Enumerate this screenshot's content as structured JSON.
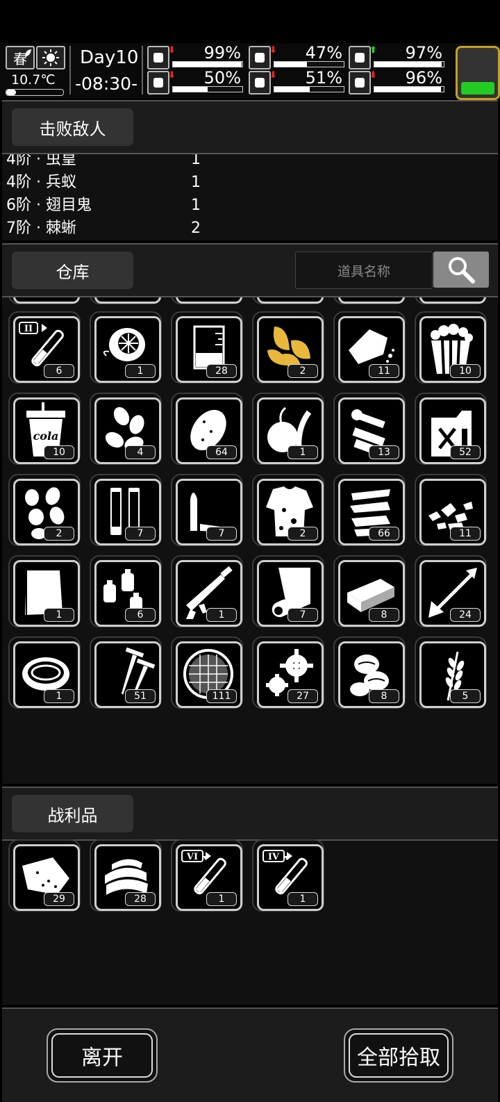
{
  "status": {
    "season": "春",
    "temperature": "10.7℃",
    "day": "Day10",
    "time": "-08:30-",
    "stats": [
      {
        "icon": "medkit-icon",
        "arrow": "down",
        "arrow_color": "#ff2020",
        "pct_text": "99%",
        "value": 0.99
      },
      {
        "icon": "stomach-icon",
        "arrow": "down",
        "arrow_color": "#ff2020",
        "pct_text": "47%",
        "value": 0.47
      },
      {
        "icon": "pill-icon",
        "arrow": "up",
        "arrow_color": "#22dd22",
        "pct_text": "97%",
        "value": 0.97
      },
      {
        "icon": "boot-icon",
        "arrow": "down",
        "arrow_color": "#ff2020",
        "pct_text": "50%",
        "value": 0.5
      },
      {
        "icon": "water-drop-icon",
        "arrow": "down",
        "arrow_color": "#ff2020",
        "pct_text": "51%",
        "value": 0.51
      },
      {
        "icon": "heart-icon",
        "arrow": "down",
        "arrow_color": "#ff2020",
        "pct_text": "96%",
        "value": 0.96
      }
    ],
    "battery_color": "#22cc22"
  },
  "defeat": {
    "title": "击败敌人",
    "rows": [
      {
        "name": "4阶 · 虫皇",
        "count": "1"
      },
      {
        "name": "4阶 · 兵蚁",
        "count": "1"
      },
      {
        "name": "6阶 · 翅目鬼",
        "count": "1"
      },
      {
        "name": "7阶 · 棘蜥",
        "count": "2"
      }
    ]
  },
  "warehouse": {
    "title": "仓库",
    "search_placeholder": "道具名称",
    "items": [
      {
        "icon": "test-tube-ii-icon",
        "count": "6"
      },
      {
        "icon": "orange-slice-icon",
        "count": "1"
      },
      {
        "icon": "beaker-icon",
        "count": "28"
      },
      {
        "icon": "tobacco-leaves-icon",
        "count": "2"
      },
      {
        "icon": "bread-chunk-icon",
        "count": "11"
      },
      {
        "icon": "popcorn-icon",
        "count": "10"
      },
      {
        "icon": "cola-cup-icon",
        "count": "10",
        "label": "cola"
      },
      {
        "icon": "seeds-icon",
        "count": "4"
      },
      {
        "icon": "potato-icon",
        "count": "64"
      },
      {
        "icon": "onion-icon",
        "count": "1"
      },
      {
        "icon": "scrap-parts-icon",
        "count": "13"
      },
      {
        "icon": "fuel-can-icon",
        "count": "52"
      },
      {
        "icon": "garlic-cloves-icon",
        "count": "2"
      },
      {
        "icon": "shell-casings-icon",
        "count": "7"
      },
      {
        "icon": "bullet-icon",
        "count": "7"
      },
      {
        "icon": "torn-shirt-icon",
        "count": "2"
      },
      {
        "icon": "metal-strips-icon",
        "count": "66"
      },
      {
        "icon": "rubble-icon",
        "count": "11"
      },
      {
        "icon": "cloth-icon",
        "count": "1"
      },
      {
        "icon": "bottles-icon",
        "count": "6"
      },
      {
        "icon": "caulking-gun-icon",
        "count": "1"
      },
      {
        "icon": "paper-roll-icon",
        "count": "7"
      },
      {
        "icon": "board-icon",
        "count": "8"
      },
      {
        "icon": "arrow-icon",
        "count": "24"
      },
      {
        "icon": "soup-bowl-icon",
        "count": "1"
      },
      {
        "icon": "nails-icon",
        "count": "51"
      },
      {
        "icon": "mesh-filter-icon",
        "count": "111"
      },
      {
        "icon": "gears-icon",
        "count": "27"
      },
      {
        "icon": "coffee-beans-icon",
        "count": "8"
      },
      {
        "icon": "wheat-icon",
        "count": "5"
      }
    ]
  },
  "loot": {
    "title": "战利品",
    "items": [
      {
        "icon": "meat-chunk-icon",
        "count": "29"
      },
      {
        "icon": "fabric-stack-icon",
        "count": "28"
      },
      {
        "icon": "test-tube-vi-icon",
        "count": "1",
        "roman": "VI"
      },
      {
        "icon": "test-tube-iv-icon",
        "count": "1",
        "roman": "IV"
      }
    ]
  },
  "actions": {
    "leave": "离开",
    "take_all": "全部拾取"
  },
  "colors": {
    "accent_gold": "#e8b83a",
    "panel": "#1c1c1c"
  }
}
